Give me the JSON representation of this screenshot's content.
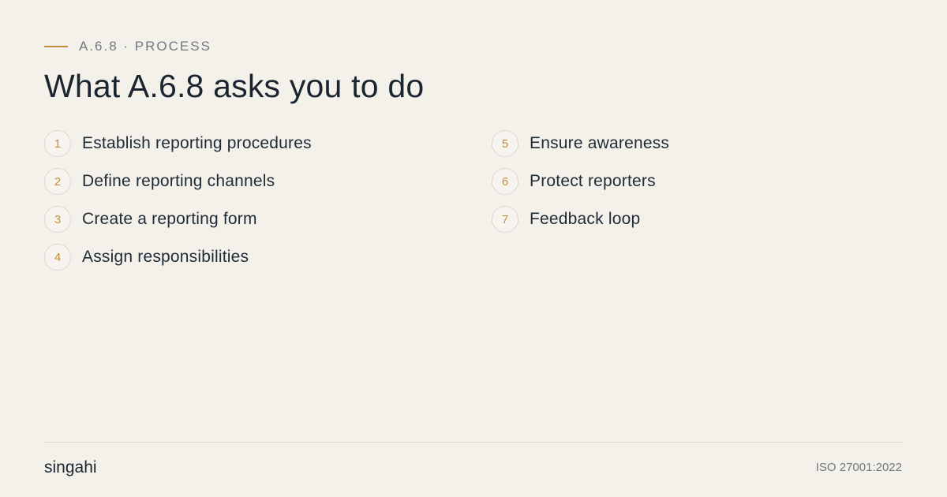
{
  "header": {
    "eyebrow": "A.6.8 · PROCESS",
    "title": "What A.6.8 asks you to do"
  },
  "steps": [
    {
      "number": "1",
      "label": "Establish reporting procedures"
    },
    {
      "number": "2",
      "label": "Define reporting channels"
    },
    {
      "number": "3",
      "label": "Create a reporting form"
    },
    {
      "number": "4",
      "label": "Assign responsibilities"
    },
    {
      "number": "5",
      "label": "Ensure awareness"
    },
    {
      "number": "6",
      "label": "Protect reporters"
    },
    {
      "number": "7",
      "label": "Feedback loop"
    }
  ],
  "footer": {
    "brand": "singahi",
    "standard": "ISO 27001:2022"
  },
  "colors": {
    "background": "#f4f1eb",
    "accent": "#c0903a",
    "text": "#1e2a36"
  }
}
